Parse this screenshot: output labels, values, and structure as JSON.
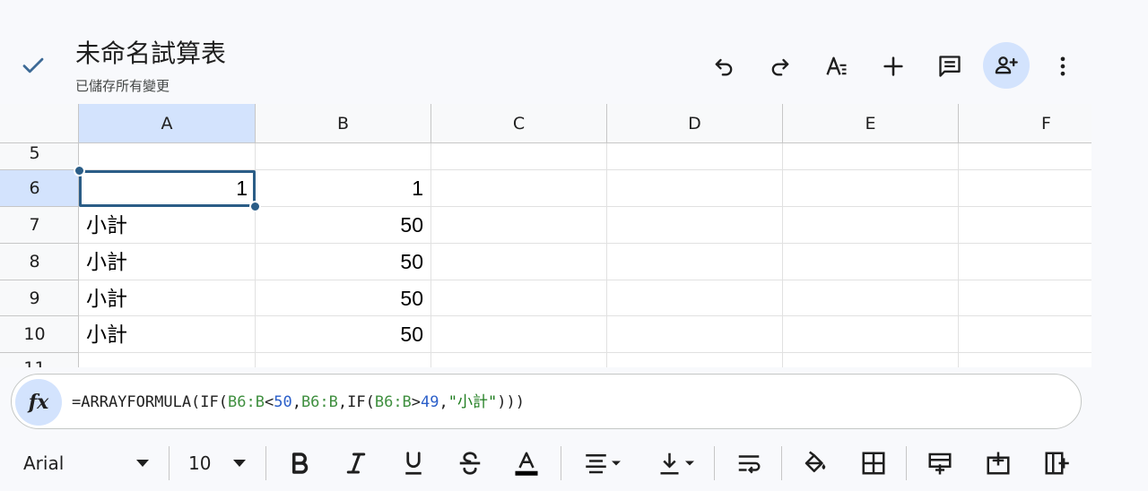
{
  "header": {
    "title": "未命名試算表",
    "subtitle": "已儲存所有變更"
  },
  "columns": [
    "A",
    "B",
    "C",
    "D",
    "E",
    "F"
  ],
  "selected_column": "A",
  "rows": [
    {
      "num": "5",
      "a": "",
      "b": ""
    },
    {
      "num": "6",
      "a": "1",
      "b": "1"
    },
    {
      "num": "7",
      "a": "小計",
      "b": "50"
    },
    {
      "num": "8",
      "a": "小計",
      "b": "50"
    },
    {
      "num": "9",
      "a": "小計",
      "b": "50"
    },
    {
      "num": "10",
      "a": "小計",
      "b": "50"
    },
    {
      "num": "11",
      "a": "",
      "b": ""
    }
  ],
  "selected_cell": "A6",
  "formula_bar": {
    "fx_label": "fx",
    "tokens": [
      {
        "t": "=ARRAYFORMULA(IF(",
        "k": "plain"
      },
      {
        "t": "B6:B",
        "k": "ref"
      },
      {
        "t": "<",
        "k": "plain"
      },
      {
        "t": "50",
        "k": "num"
      },
      {
        "t": ",",
        "k": "plain"
      },
      {
        "t": "B6:B",
        "k": "ref"
      },
      {
        "t": ",IF(",
        "k": "plain"
      },
      {
        "t": "B6:B",
        "k": "ref"
      },
      {
        "t": ">",
        "k": "plain"
      },
      {
        "t": "49",
        "k": "num"
      },
      {
        "t": ",",
        "k": "plain"
      },
      {
        "t": "\"小計\"",
        "k": "str"
      },
      {
        "t": ")))",
        "k": "plain"
      }
    ]
  },
  "toolbar": {
    "font_family": "Arial",
    "font_size": "10"
  },
  "colors": {
    "selection": "#2b5d87",
    "header_selected": "#d3e3fd",
    "share_button_bg": "#d3e3fd"
  }
}
